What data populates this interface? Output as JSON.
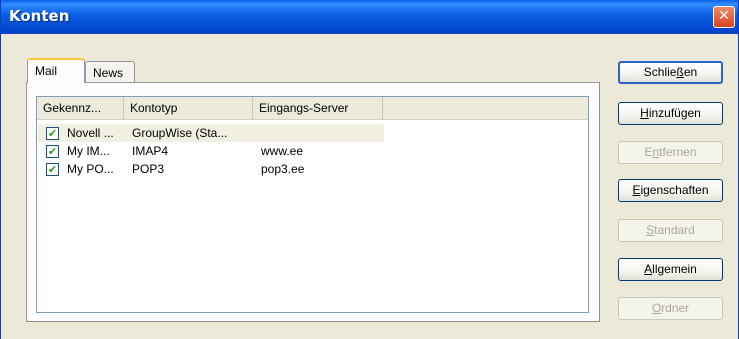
{
  "window": {
    "title": "Konten",
    "close_glyph": "✕"
  },
  "tabs": [
    {
      "label": "Mail",
      "active": true
    },
    {
      "label": "News",
      "active": false
    }
  ],
  "list": {
    "columns": [
      "Gekennz...",
      "Kontotyp",
      "Eingangs-Server"
    ],
    "rows": [
      {
        "checked": true,
        "name": "Novell ...",
        "type": "GroupWise (Sta...",
        "server": ""
      },
      {
        "checked": true,
        "name": "My IM...",
        "type": "IMAP4",
        "server": "www.ee"
      },
      {
        "checked": true,
        "name": "My PO...",
        "type": "POP3",
        "server": "pop3.ee"
      }
    ],
    "check_glyph": "✔"
  },
  "buttons": {
    "close": {
      "pre": "Schlie",
      "key": "ß",
      "post": "en"
    },
    "add": {
      "pre": "",
      "key": "H",
      "post": "inzufügen"
    },
    "remove": {
      "pre": "E",
      "key": "n",
      "post": "tfernen"
    },
    "properties": {
      "pre": "",
      "key": "E",
      "post": "igenschaften"
    },
    "standard": {
      "pre": "",
      "key": "S",
      "post": "tandard"
    },
    "general": {
      "pre": "",
      "key": "A",
      "post": "llgemein"
    },
    "folder": {
      "pre": "",
      "key": "O",
      "post": "rdner"
    }
  },
  "colors": {
    "titlebar": "#0a5de0",
    "window_bg": "#ece9d8",
    "tab_highlight": "#ffc83c",
    "check": "#21a121"
  }
}
